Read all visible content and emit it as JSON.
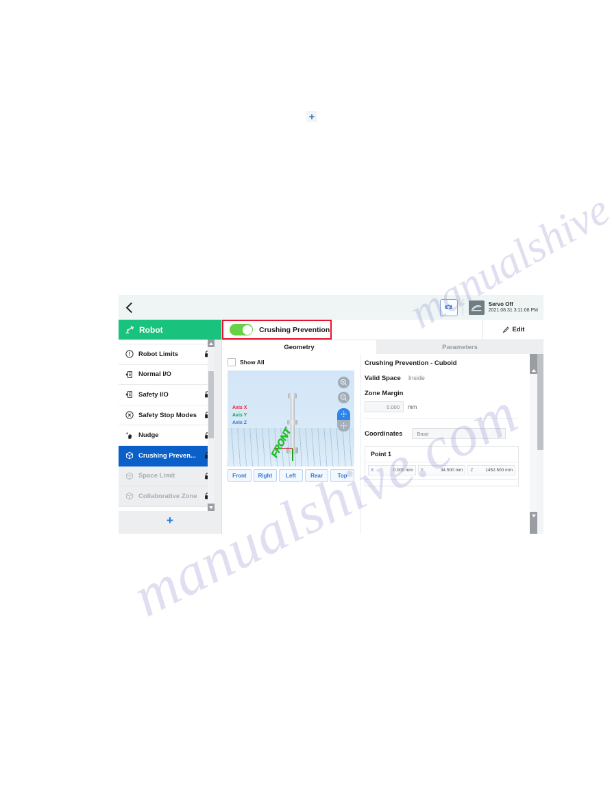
{
  "topbar": {
    "back_icon": "chevron-left-icon",
    "reload_icon": "reload-icon",
    "servo_icon": "servo-icon",
    "status_title": "Servo Off",
    "status_time": "2021.08.31 3:11:08 PM"
  },
  "sidebar": {
    "header_label": "Robot",
    "header_icon": "robot-arm-icon",
    "add_label": "+",
    "items": [
      {
        "label": "Robot Limits",
        "icon": "warning-circle-icon",
        "locked": true,
        "state": "normal"
      },
      {
        "label": "Normal I/O",
        "icon": "io-box-icon",
        "locked": false,
        "state": "normal"
      },
      {
        "label": "Safety I/O",
        "icon": "io-box-icon",
        "locked": true,
        "state": "normal"
      },
      {
        "label": "Safety Stop Modes",
        "icon": "x-circle-icon",
        "locked": true,
        "state": "normal"
      },
      {
        "label": "Nudge",
        "icon": "hand-nudge-icon",
        "locked": true,
        "state": "normal"
      },
      {
        "label": "Crushing Preven...",
        "icon": "cube-icon",
        "locked": true,
        "state": "selected"
      },
      {
        "label": "Space Limit",
        "icon": "cube-icon",
        "locked": true,
        "state": "disabled"
      },
      {
        "label": "Collaborative Zone",
        "icon": "cube-icon",
        "locked": true,
        "state": "disabled"
      }
    ]
  },
  "main": {
    "toggle_label": "Crushing Prevention",
    "toggle_on": true,
    "highlight_color": "#e8112d",
    "toggle_on_color": "#67d246",
    "edit_label": "Edit",
    "edit_icon": "pencil-icon",
    "tabs": [
      {
        "label": "Geometry",
        "active": true
      },
      {
        "label": "Parameters",
        "active": false
      }
    ]
  },
  "geometry": {
    "show_all_label": "Show All",
    "show_all_checked": false,
    "axis_labels": [
      {
        "label": "Axis X",
        "color": "#e0282e"
      },
      {
        "label": "Axis Y",
        "color": "#17a24a"
      },
      {
        "label": "Axis Z",
        "color": "#2f74d8"
      }
    ],
    "front_badge": "FRONT",
    "zoom_in_icon": "magnifier-plus-icon",
    "zoom_out_icon": "magnifier-minus-icon",
    "pan_icon": "pan-move-icon",
    "rotate_icon": "rotate-icon",
    "view_buttons": [
      "Front",
      "Right",
      "Left",
      "Rear",
      "Top"
    ]
  },
  "details": {
    "title": "Crushing Prevention - Cuboid",
    "valid_space_label": "Valid Space",
    "valid_space_value": "Inside",
    "zone_margin_label": "Zone Margin",
    "zone_margin_value": "0.000",
    "zone_margin_unit": "mm",
    "coordinates_label": "Coordinates",
    "coordinates_value": "Base",
    "point_title": "Point 1",
    "point_fields": [
      {
        "key": "X",
        "value": "0.000 mm"
      },
      {
        "key": "Y",
        "value": "34.500 mm"
      },
      {
        "key": "Z",
        "value": "1452.500 mm"
      }
    ]
  },
  "page": {
    "floating_plus": "+",
    "watermark_1": "manualshive.com",
    "watermark_2": "manualshive.com"
  }
}
